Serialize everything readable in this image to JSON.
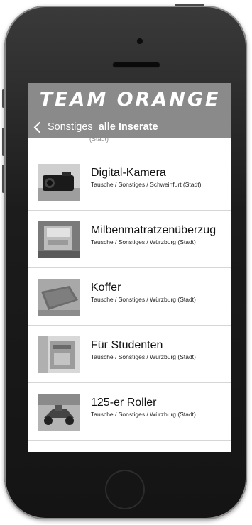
{
  "app": {
    "brand": "TEAM ORANGE"
  },
  "navbar": {
    "back_label": "Sonstiges",
    "title": "alle Inserate"
  },
  "listings": [
    {
      "name": "Digital-Kamera",
      "path": "Tausche / Sonstiges / Schweinfurt (Stadt)",
      "thumb_icon": "camera-photo"
    },
    {
      "name": "Milbenmatratzenüberzug",
      "path": "Tausche / Sonstiges / Würzburg (Stadt)",
      "thumb_icon": "mattress-cover-photo"
    },
    {
      "name": "Koffer",
      "path": "Tausche / Sonstiges / Würzburg (Stadt)",
      "thumb_icon": "suitcase-photo"
    },
    {
      "name": "Für Studenten",
      "path": "Tausche / Sonstiges / Würzburg (Stadt)",
      "thumb_icon": "student-items-photo"
    },
    {
      "name": "125-er Roller",
      "path": "Tausche / Sonstiges / Würzburg (Stadt)",
      "thumb_icon": "scooter-photo"
    }
  ],
  "colors": {
    "header_gray": "#8a8a8a",
    "phone_body": "#1c1c1c",
    "divider": "#d6d6d6"
  }
}
